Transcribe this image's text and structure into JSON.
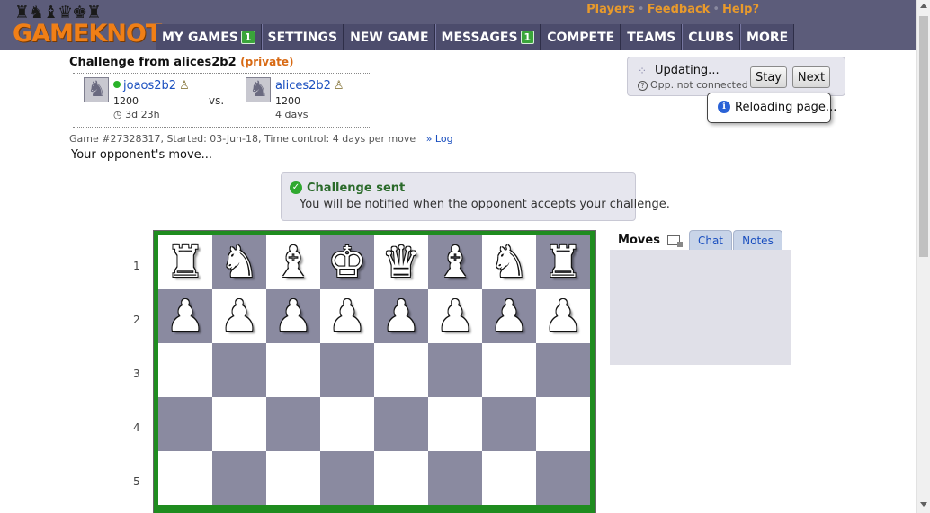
{
  "header": {
    "logo_pieces": "♜♞♝♛♚♜",
    "logo_text": "GAMEKNOT",
    "top_links": [
      "Players",
      "Feedback",
      "Help?"
    ],
    "nav": [
      {
        "label": "MY GAMES",
        "badge": "1"
      },
      {
        "label": "SETTINGS",
        "badge": null
      },
      {
        "label": "NEW GAME",
        "badge": null
      },
      {
        "label": "MESSAGES",
        "badge": "1"
      },
      {
        "label": "COMPETE",
        "badge": null
      },
      {
        "label": "TEAMS",
        "badge": null
      },
      {
        "label": "CLUBS",
        "badge": null
      },
      {
        "label": "MORE",
        "badge": null
      }
    ]
  },
  "challenge": {
    "title": "Challenge from alices2b2",
    "private_label": "(private)",
    "vs": "vs.",
    "player1": {
      "name": "joaos2b2",
      "rating": "1200",
      "time": "◷ 3d 23h",
      "pawn_icon": "♙"
    },
    "player2": {
      "name": "alices2b2",
      "rating": "1200",
      "time": "4 days",
      "pawn_icon": "♙"
    },
    "game_info": "Game #27328317, Started: 03-Jun-18, Time control: 4 days per move",
    "log_link": "» Log",
    "opponent_move": "Your opponent's move..."
  },
  "status": {
    "spinner": "⁘",
    "updating": "Updating...",
    "help_icon": "?",
    "opp_status": "Opp. not connected",
    "stay_label": "Stay",
    "next_label": "Next",
    "reloading": "Reloading page..."
  },
  "sent": {
    "title": "Challenge sent",
    "text": "You will be notified when the opponent accepts your challenge."
  },
  "board": {
    "ranks": [
      "1",
      "2",
      "3",
      "4",
      "5"
    ],
    "rows": [
      [
        "♜",
        "♞",
        "♝",
        "♚",
        "♛",
        "♝",
        "♞",
        "♜"
      ],
      [
        "♟",
        "♟",
        "♟",
        "♟",
        "♟",
        "♟",
        "♟",
        "♟"
      ],
      [
        "",
        "",
        "",
        "",
        "",
        "",
        "",
        ""
      ],
      [
        "",
        "",
        "",
        "",
        "",
        "",
        "",
        ""
      ],
      [
        "",
        "",
        "",
        "",
        "",
        "",
        "",
        ""
      ]
    ],
    "light_color": "#ffffff",
    "dark_color": "#8a8aa0",
    "border_color": "#1f8c1f"
  },
  "panel": {
    "tab_moves": "Moves",
    "tab_chat": "Chat",
    "tab_notes": "Notes"
  }
}
